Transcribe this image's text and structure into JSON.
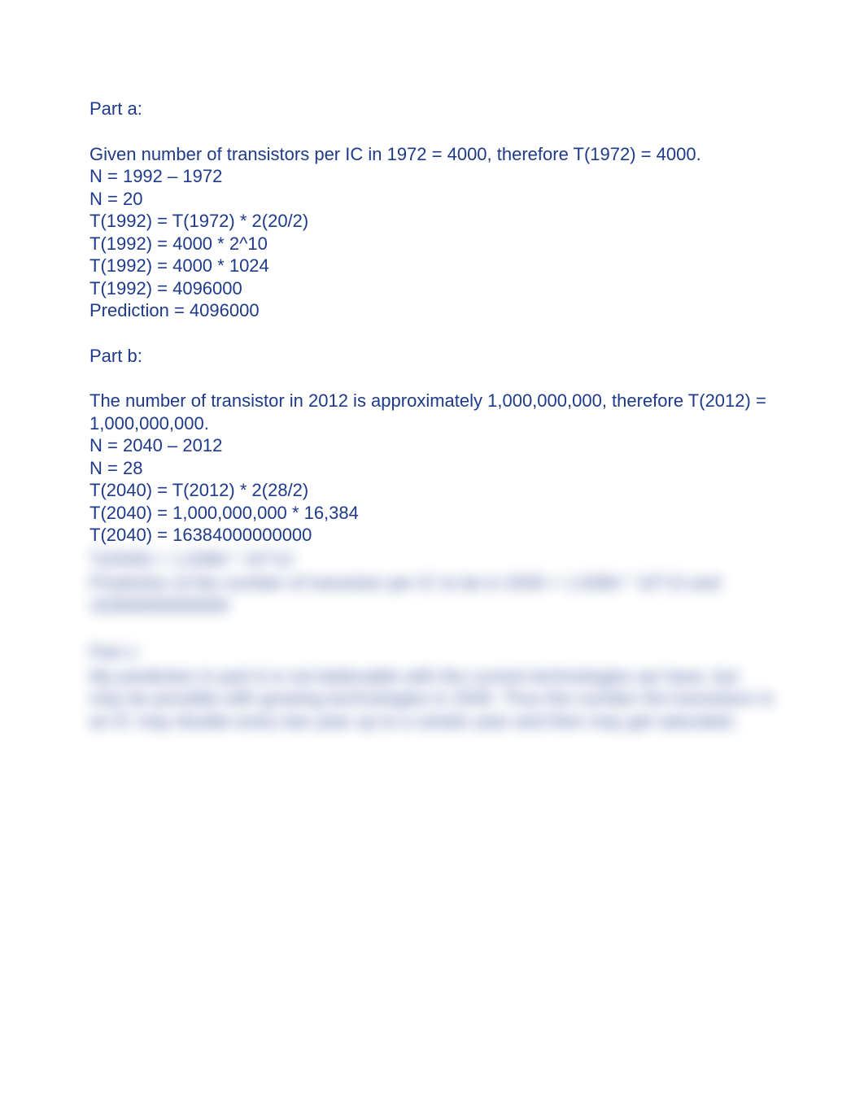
{
  "colors": {
    "text": "#1e3a8a",
    "background": "#ffffff"
  },
  "partA": {
    "header": "Part a:",
    "intro": "Given number of transistors per IC in 1972 = 4000, therefore T(1972) = 4000.",
    "lines": [
      "N = 1992 – 1972",
      "N = 20",
      "T(1992) = T(1972) * 2(20/2)",
      "T(1992) = 4000 * 2^10",
      "T(1992) = 4000 * 1024",
      "T(1992) = 4096000",
      "Prediction = 4096000"
    ]
  },
  "partB": {
    "header": "Part b:",
    "intro": "The number of transistor in 2012 is approximately 1,000,000,000, therefore T(2012) = 1,000,000,000.",
    "lines": [
      "N = 2040 – 2012",
      "N = 28",
      "T(2040) = T(2012) * 2(28/2)",
      "T(2040) = 1,000,000,000 * 16,384",
      "T(2040) = 16384000000000"
    ]
  },
  "blurred": {
    "lines": [
      "T(2040) = 1.6384 * 10^13",
      "Prediction of the number of transistor per IC to be in 2040 = 1.6384 * 10^13 and 16384000000000",
      "",
      "Part c:",
      "My prediction in part b is not believable with the current technologies we have, but may be possible with growing technologies in 2040. Thus the number the transistors in an IC may double every two year up to a certain year and then may get saturated."
    ]
  }
}
